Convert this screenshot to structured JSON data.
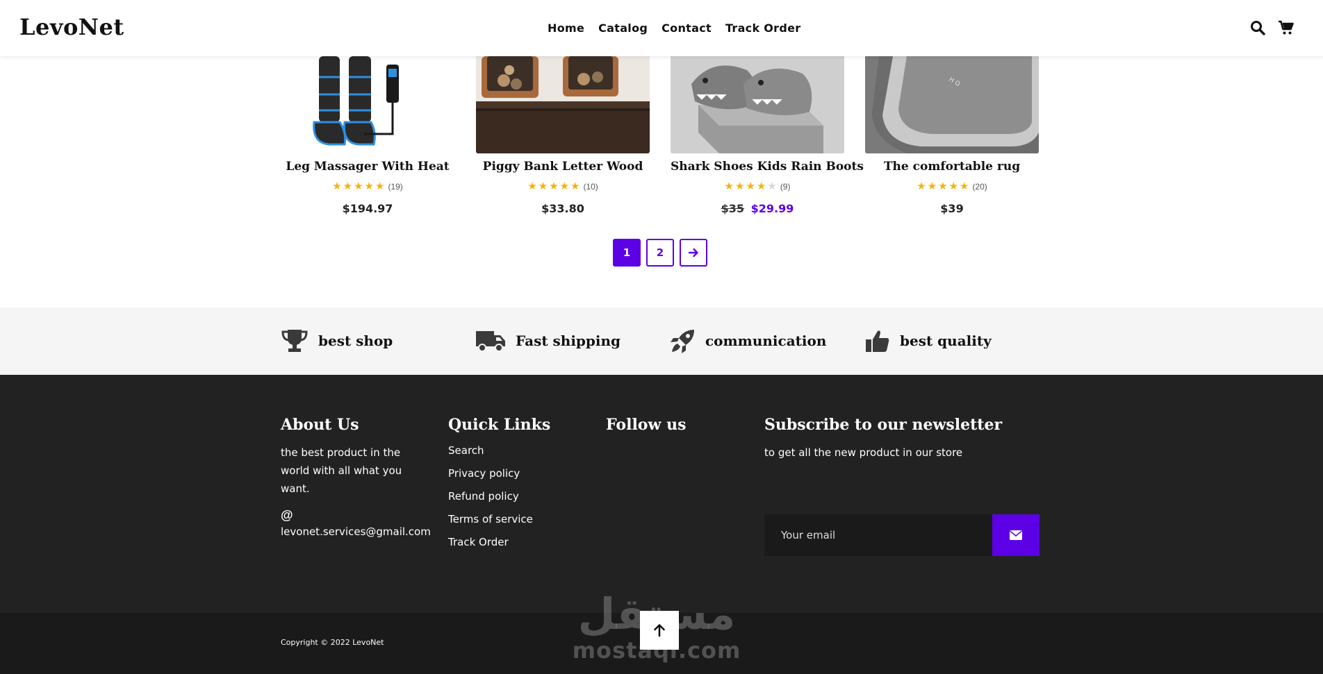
{
  "header": {
    "logo": "LevoNet",
    "nav": [
      "Home",
      "Catalog",
      "Contact",
      "Track Order"
    ],
    "icons": [
      "search-icon",
      "cart-icon"
    ]
  },
  "products": [
    {
      "name": "Leg Massager With Heat",
      "stars": 5,
      "reviews": "(19)",
      "price": "$194.97",
      "old_price": "",
      "sale_price": ""
    },
    {
      "name": "Piggy Bank Letter Wood",
      "stars": 5,
      "reviews": "(10)",
      "price": "$33.80",
      "old_price": "",
      "sale_price": ""
    },
    {
      "name": "Shark Shoes Kids Rain Boots",
      "stars": 4,
      "reviews": "(9)",
      "price": "",
      "old_price": "$35",
      "sale_price": "$29.99"
    },
    {
      "name": "The comfortable rug",
      "stars": 5,
      "reviews": "(20)",
      "price": "$39",
      "old_price": "",
      "sale_price": ""
    }
  ],
  "pagination": {
    "pages": [
      "1",
      "2"
    ],
    "current": "1",
    "next_icon": "arrow-right-icon"
  },
  "features": [
    {
      "label": "best shop",
      "icon": "trophy-icon"
    },
    {
      "label": "Fast shipping",
      "icon": "truck-icon"
    },
    {
      "label": "communication",
      "icon": "rocket-icon"
    },
    {
      "label": "best quality",
      "icon": "thumbs-up-icon"
    }
  ],
  "footer": {
    "about": {
      "title": "About Us",
      "text": "the best product in the world with all what you want.",
      "at_symbol": "@",
      "email": "levonet.services@gmail.com"
    },
    "quick_links": {
      "title": "Quick Links",
      "items": [
        "Search",
        "Privacy policy",
        "Refund policy",
        "Terms of service",
        "Track Order"
      ]
    },
    "follow": {
      "title": "Follow us"
    },
    "newsletter": {
      "title": "Subscribe to our newsletter",
      "subtitle": "to get all the new product in our store",
      "placeholder": "Your email",
      "button_icon": "envelope-icon"
    },
    "copyright": "Copyright © 2022 LevoNet",
    "back_to_top_icon": "arrow-up-icon"
  },
  "watermark": {
    "arabic": "مستقل",
    "latin": "mostaql.com"
  },
  "colors": {
    "accent": "#5c00e6",
    "star": "#f5b301",
    "footer_bg": "#222222",
    "features_bg": "#f5f5f5"
  }
}
